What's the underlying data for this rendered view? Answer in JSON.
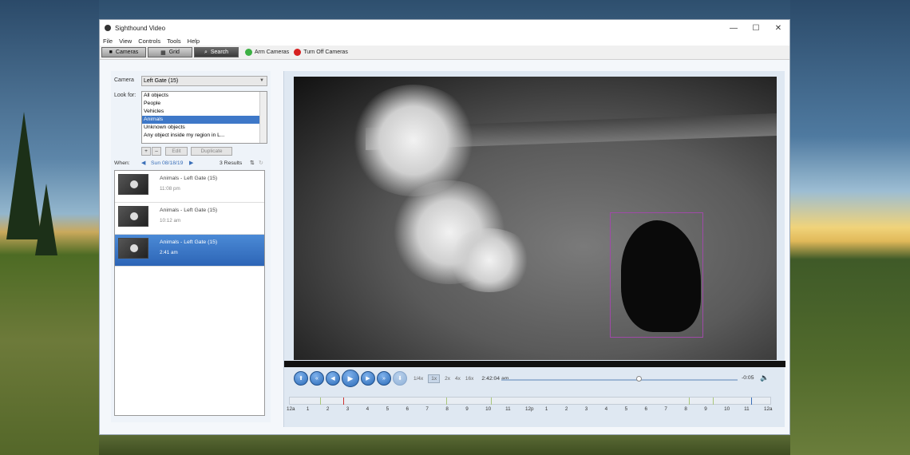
{
  "window": {
    "title": "Sighthound Video",
    "controls": [
      "—",
      "☐",
      "✕"
    ]
  },
  "menu": [
    "File",
    "View",
    "Controls",
    "Tools",
    "Help"
  ],
  "toolbar": {
    "tabs": [
      {
        "label": "Cameras",
        "icon": "camera-icon"
      },
      {
        "label": "Grid",
        "icon": "grid-icon"
      },
      {
        "label": "Search",
        "icon": "search-icon"
      }
    ],
    "arm_label": "Arm Cameras",
    "arm_color": "#3cb043",
    "off_label": "Turn Off Cameras",
    "off_color": "#d62020"
  },
  "search": {
    "camera_label": "Camera",
    "camera_value": "Left Gate (15)",
    "look_label": "Look for:",
    "look_options": [
      "All objects",
      "People",
      "Vehicles",
      "Animals",
      "Unknown objects",
      "Any object inside my region in L..."
    ],
    "look_selected_index": 3,
    "btn_add": "+",
    "btn_remove": "–",
    "btn_edit": "Edit",
    "btn_duplicate": "Duplicate",
    "when_label": "When:",
    "date": "Sun 08/18/19",
    "results_count": "3 Results",
    "results": [
      {
        "title": "Animals - Left Gate (15)",
        "time": "11:08 pm"
      },
      {
        "title": "Animals - Left Gate (15)",
        "time": "10:12 am"
      },
      {
        "title": "Animals - Left Gate (15)",
        "time": "2:41 am"
      }
    ],
    "selected_result": 2
  },
  "playback": {
    "speeds": [
      "1/4x",
      "1x",
      "2x",
      "4x",
      "16x"
    ],
    "selected_speed": 1,
    "timecode": "2:42:04 am",
    "remaining": "-0:05",
    "progress": 0.58,
    "timeline_labels": [
      "12a",
      "1",
      "2",
      "3",
      "4",
      "5",
      "6",
      "7",
      "8",
      "9",
      "10",
      "11",
      "12p",
      "1",
      "2",
      "3",
      "4",
      "5",
      "6",
      "7",
      "8",
      "9",
      "10",
      "11",
      "12a"
    ]
  }
}
